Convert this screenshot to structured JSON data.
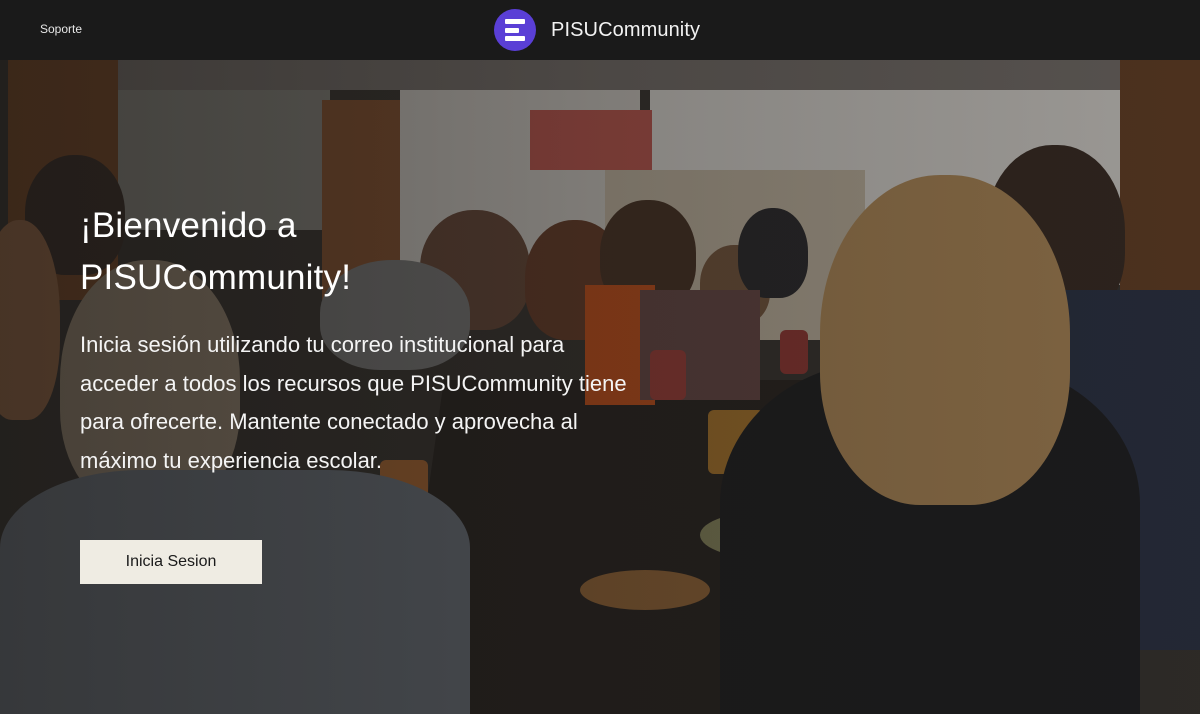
{
  "header": {
    "support_label": "Soporte",
    "brand_name": "PISUCommunity",
    "logo_icon": "stacked-bars-logo-icon"
  },
  "hero": {
    "title_line1": "¡Bienvenido a",
    "title_line2": "PISUCommunity!",
    "description": "Inicia sesión utilizando tu correo institucional para acceder a todos los recursos que PISUCommunity tiene para ofrecerte. Mantente conectado y aprovecha al máximo tu experiencia escolar.",
    "login_button_label": "Inicia Sesion"
  },
  "colors": {
    "topbar": "#1a1a1a",
    "logo": "#5a3fd6",
    "button_bg": "#efece3"
  }
}
